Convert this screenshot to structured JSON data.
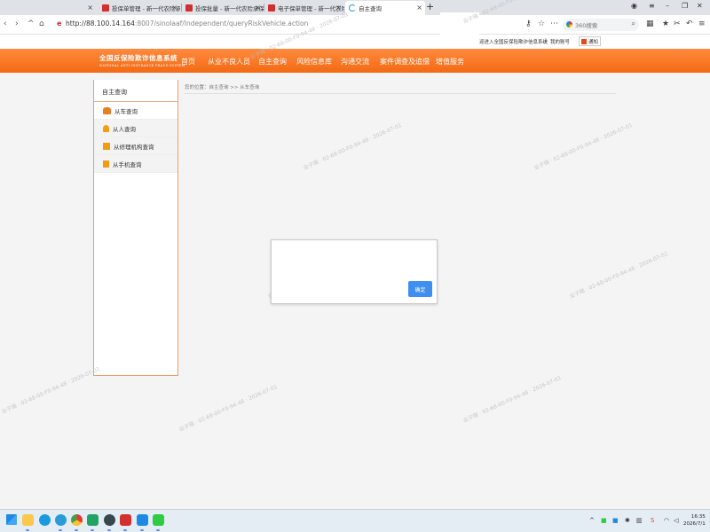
{
  "browser": {
    "tabs": [
      {
        "label": ""
      },
      {
        "label": "投保单管理 - 新一代农险承保"
      },
      {
        "label": "投保批量 - 新一代农险承保平"
      },
      {
        "label": "电子保单管理 - 新一代农险承"
      },
      {
        "label": "自主查询"
      }
    ],
    "url_host": "http://88.100.14.164",
    "url_rest": ":8007/sinolaaf/Independent/queryRiskVehicle.action",
    "search_placeholder": "360搜索"
  },
  "site": {
    "top_text": "迎进入全国反保险欺诈信息系统",
    "top_divider": "|",
    "account_label": "我的账号",
    "mail_label": "通知",
    "logo_cn": "全国反保险欺诈信息系统",
    "logo_en": "NATIONAL ANTI INSURANCE FRAUD SYSTEM",
    "menu": [
      {
        "label": "首页"
      },
      {
        "label": "从业不良人员"
      },
      {
        "label": "自主查询"
      },
      {
        "label": "风险信息库"
      },
      {
        "label": "沟通交流"
      },
      {
        "label": "案件调查及追偿"
      },
      {
        "label": "增值服务"
      }
    ]
  },
  "sidebar": {
    "title": "自主查询",
    "items": [
      {
        "label": "从车查询",
        "icon": "car-icon"
      },
      {
        "label": "从人查询",
        "icon": "person-icon"
      },
      {
        "label": "从修理机构查询",
        "icon": "org-icon"
      },
      {
        "label": "从手机查询",
        "icon": "phone-icon"
      }
    ]
  },
  "breadcrumb": "您的位置：自主查询 >> 从车查询",
  "dialog": {
    "message": "",
    "ok_label": "确定"
  },
  "watermark": "业子瑞 · 02-68-00-F0-94-48 · 2026-07-01",
  "taskbar": {
    "time": "16:35",
    "date": "2026/7/1"
  },
  "colors": {
    "nav_orange": "#f36a14",
    "ok_blue": "#3f8ff0"
  }
}
